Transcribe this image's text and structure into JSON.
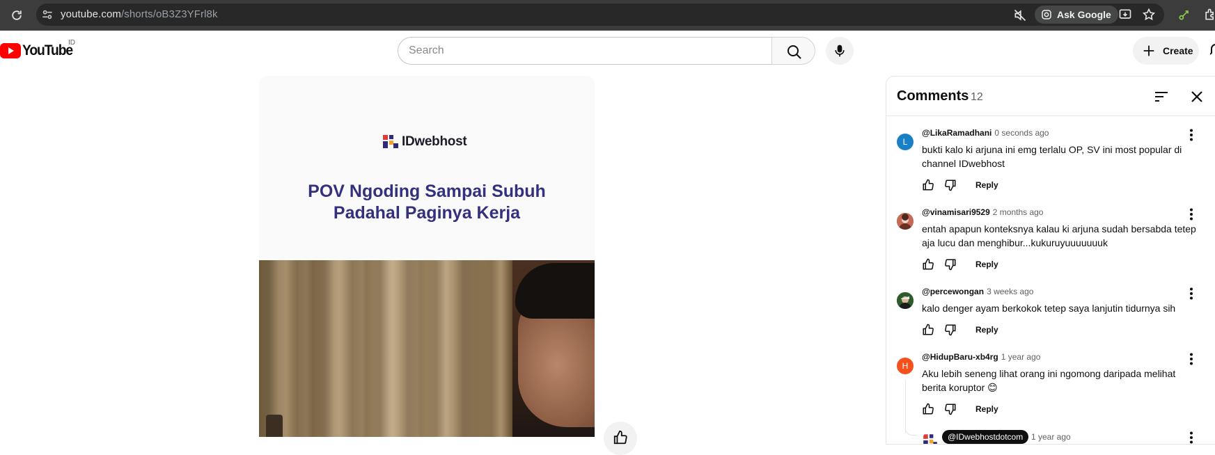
{
  "browser": {
    "url_host": "youtube.com",
    "url_path": "/shorts/oB3Z3YFrl8k",
    "ask_google": "Ask Google"
  },
  "header": {
    "logo_text": "YouTube",
    "country_code": "ID",
    "search_placeholder": "Search",
    "create_label": "Create"
  },
  "short": {
    "brand": "IDwebhost",
    "title_line1": "POV Ngoding Sampai Subuh",
    "title_line2": "Padahal Paginya Kerja"
  },
  "comments": {
    "title": "Comments",
    "count": "12",
    "reply_label": "Reply",
    "items": [
      {
        "author": "@LikaRamadhani",
        "time": "0 seconds ago",
        "text": "bukti kalo ki arjuna ini emg terlalu OP, SV ini most popular di channel IDwebhost",
        "avatar_letter": "L",
        "avatar_color": "#1a7fc7"
      },
      {
        "author": "@vinamisari9529",
        "time": "2 months ago",
        "text": "entah apapun konteksnya kalau ki arjuna sudah bersabda tetep aja lucu dan menghibur...kukuruyuuuuuuuk",
        "avatar_letter": "",
        "avatar_color": "#b0523e"
      },
      {
        "author": "@percewongan",
        "time": "3 weeks ago",
        "text": "kalo denger ayam berkokok tetep saya lanjutin tidurnya sih",
        "avatar_letter": "",
        "avatar_color": "#3d6b3a"
      },
      {
        "author": "@HidupBaru-xb4rg",
        "time": "1 year ago",
        "text": "Aku lebih seneng lihat orang ini ngomong daripada melihat berita koruptor 😊",
        "avatar_letter": "H",
        "avatar_color": "#f4511e"
      }
    ],
    "reply_preview": {
      "author": "@IDwebhostdotcom",
      "time": "1 year ago"
    }
  }
}
